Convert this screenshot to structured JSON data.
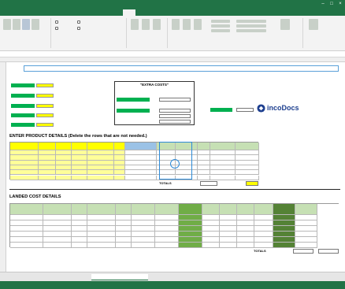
{
  "window": {
    "title": ""
  },
  "menu": {
    "tabs": [
      {
        "label": ""
      },
      {
        "label": ""
      },
      {
        "label": ""
      },
      {
        "label": ""
      },
      {
        "label": ""
      },
      {
        "label": ""
      },
      {
        "label": ""
      },
      {
        "label": ""
      },
      {
        "label": ""
      },
      {
        "label": ""
      },
      {
        "label": ""
      }
    ],
    "tell_me": "",
    "share": ""
  },
  "ribbon": {
    "groups": [
      "",
      "",
      "",
      "",
      ""
    ]
  },
  "sheet": {
    "banner": "",
    "instruction": "",
    "left_labels": [
      {
        "label": "",
        "sub": ""
      },
      {
        "label": "",
        "sub": ""
      },
      {
        "label": "",
        "sub": ""
      },
      {
        "label": "",
        "sub": ""
      },
      {
        "label": "",
        "sub": ""
      }
    ],
    "extra_costs": {
      "title": "\"EXTRA COSTS\"",
      "rows": [
        "",
        "",
        "",
        ""
      ]
    },
    "notes": {
      "text": "",
      "red": ""
    },
    "logo": "incoDocs",
    "product_section": "ENTER PRODUCT DETAILS (Delete the rows that are not needed.)",
    "product_headers": [
      "",
      "",
      "",
      "",
      "",
      "",
      "",
      "",
      "",
      "",
      "",
      ""
    ],
    "product_rows": [
      [
        "",
        "",
        "",
        "",
        "",
        "",
        "",
        "",
        "",
        "",
        "",
        ""
      ],
      [
        "",
        "",
        "",
        "",
        "",
        "",
        "",
        "",
        "",
        "",
        "",
        ""
      ],
      [
        "",
        "",
        "",
        "",
        "",
        "",
        "",
        "",
        "",
        "",
        "",
        ""
      ],
      [
        "",
        "",
        "",
        "",
        "",
        "",
        "",
        "",
        "",
        "",
        "",
        ""
      ],
      [
        "",
        "",
        "",
        "",
        "",
        "",
        "",
        "",
        "",
        "",
        "",
        ""
      ],
      [
        "",
        "",
        "",
        "",
        "",
        "",
        "",
        "",
        "",
        "",
        "",
        ""
      ]
    ],
    "side_link": "",
    "totals_label": "TOTALS",
    "totals_value": "",
    "landed_section": "LANDED COST DETAILS",
    "landed_subtitle": "",
    "landed_headers": [
      "",
      "",
      "",
      "",
      "",
      "",
      "",
      "",
      "",
      "",
      "",
      "",
      "",
      ""
    ],
    "landed_rows": [
      [
        "",
        "",
        "",
        "",
        "",
        "",
        "",
        "",
        "",
        "",
        "",
        "",
        "",
        ""
      ],
      [
        "",
        "",
        "",
        "",
        "",
        "",
        "",
        "",
        "",
        "",
        "",
        "",
        "",
        ""
      ],
      [
        "",
        "",
        "",
        "",
        "",
        "",
        "",
        "",
        "",
        "",
        "",
        "",
        "",
        ""
      ],
      [
        "",
        "",
        "",
        "",
        "",
        "",
        "",
        "",
        "",
        "",
        "",
        "",
        "",
        ""
      ],
      [
        "",
        "",
        "",
        "",
        "",
        "",
        "",
        "",
        "",
        "",
        "",
        "",
        "",
        ""
      ],
      [
        "",
        "",
        "",
        "",
        "",
        "",
        "",
        "",
        "",
        "",
        "",
        "",
        "",
        ""
      ]
    ],
    "landed_total_label": "TOTALS",
    "landed_total_value": "",
    "landed_total_value2": ""
  },
  "sheet_tabs": [
    {
      "label": ""
    },
    {
      "label": ""
    }
  ],
  "status": {
    "left": "",
    "right": ""
  }
}
